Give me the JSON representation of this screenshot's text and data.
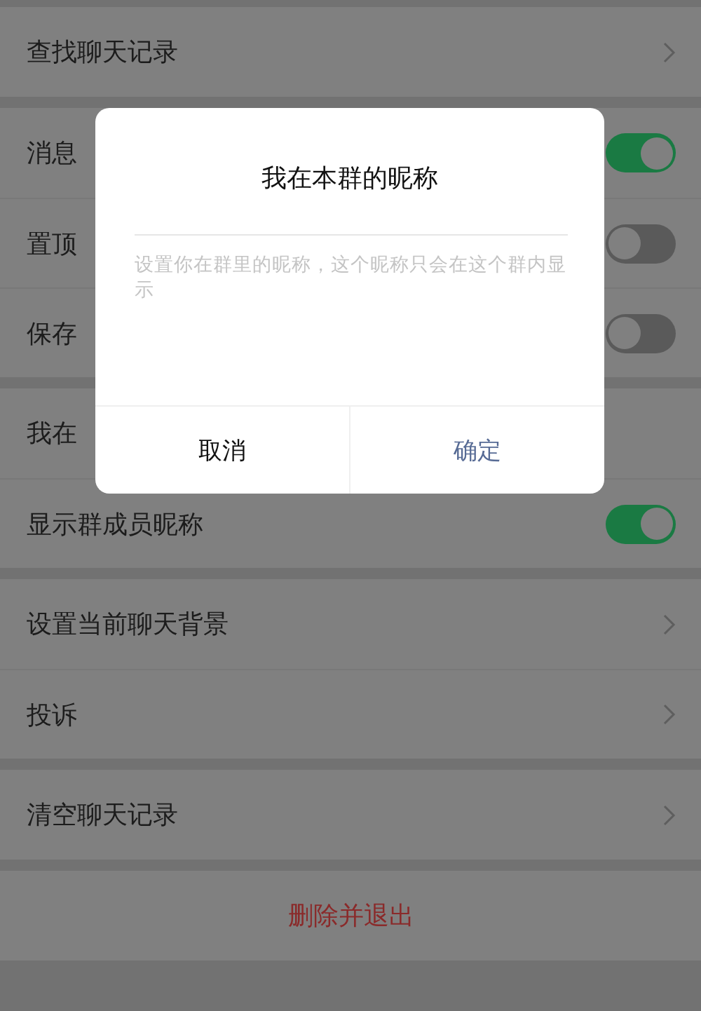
{
  "sections": [
    {
      "rows": [
        {
          "kind": "link",
          "label": "查找聊天记录"
        }
      ]
    },
    {
      "rows": [
        {
          "kind": "switch",
          "label": "消息",
          "on": true
        },
        {
          "kind": "switch",
          "label": "置顶",
          "on": false
        },
        {
          "kind": "switch",
          "label": "保存",
          "on": false
        }
      ]
    },
    {
      "rows": [
        {
          "kind": "plain",
          "label": "我在"
        },
        {
          "kind": "switch",
          "label": "显示群成员昵称",
          "on": true
        }
      ]
    },
    {
      "rows": [
        {
          "kind": "link",
          "label": "设置当前聊天背景"
        },
        {
          "kind": "link",
          "label": "投诉"
        }
      ]
    },
    {
      "rows": [
        {
          "kind": "link",
          "label": "清空聊天记录"
        }
      ]
    },
    {
      "rows": [
        {
          "kind": "danger",
          "label": "删除并退出"
        }
      ]
    }
  ],
  "dialog": {
    "title": "我在本群的昵称",
    "placeholder": "设置你在群里的昵称，这个昵称只会在这个群内显示",
    "buttons": [
      {
        "kind": "cancel",
        "label": "取消"
      },
      {
        "kind": "confirm",
        "label": "确定"
      }
    ]
  }
}
